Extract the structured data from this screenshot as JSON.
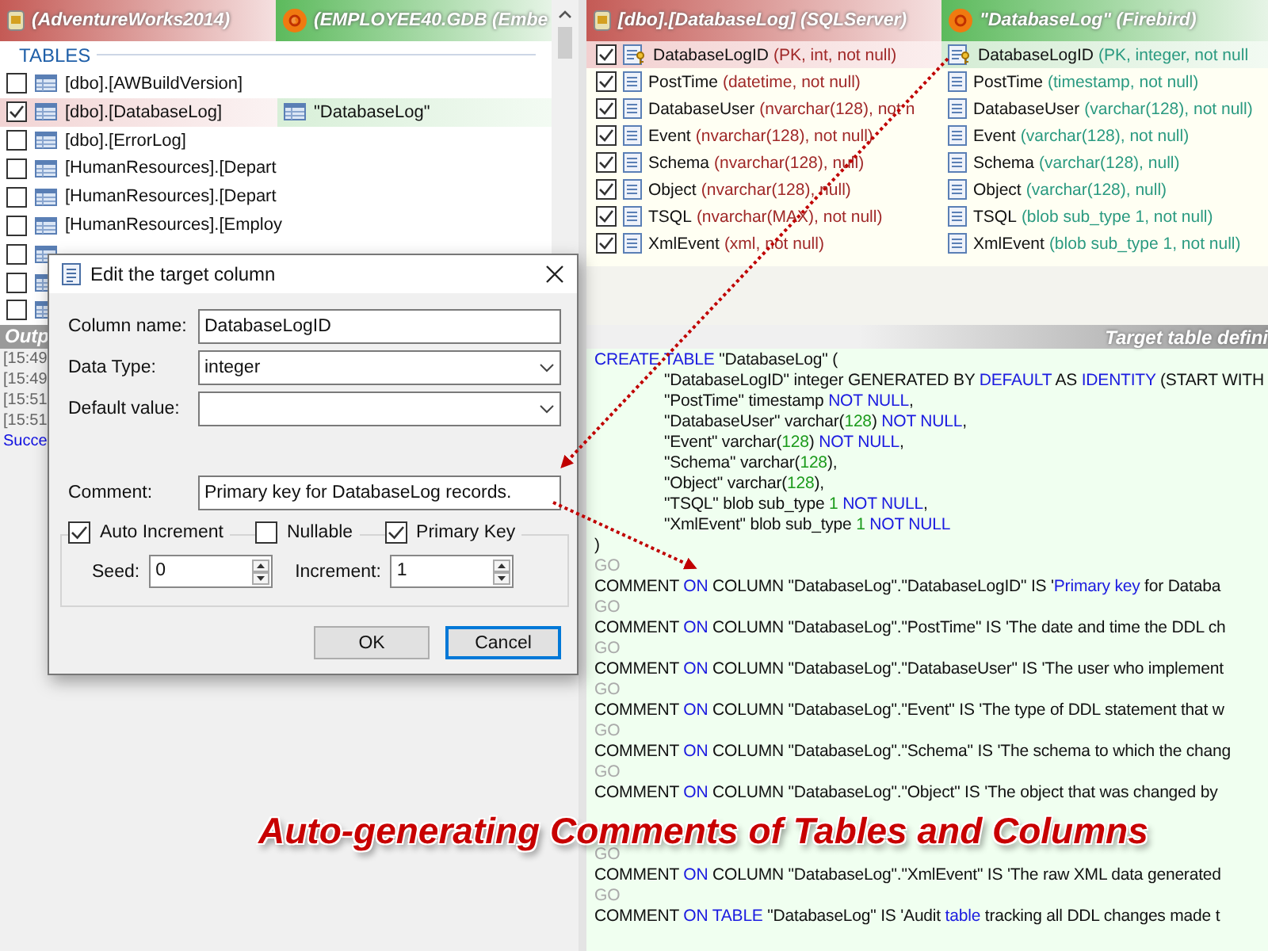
{
  "tables_pane": {
    "headers": [
      {
        "text": "(AdventureWorks2014)",
        "kind": "source"
      },
      {
        "text": "(EMPLOYEE40.GDB (Embe",
        "kind": "target"
      }
    ],
    "section_label": "TABLES",
    "rows": [
      {
        "source": "[dbo].[AWBuildVersion]",
        "checked": false,
        "selected": false
      },
      {
        "source": "[dbo].[DatabaseLog]",
        "target": "\"DatabaseLog\"",
        "checked": true,
        "selected": true
      },
      {
        "source": "[dbo].[ErrorLog]",
        "checked": false,
        "selected": false
      },
      {
        "source": "[HumanResources].[Depart",
        "checked": false,
        "selected": false
      },
      {
        "source": "[HumanResources].[Depart",
        "checked": false,
        "selected": false
      },
      {
        "source": "[HumanResources].[Employ",
        "checked": false,
        "selected": false
      },
      {
        "checked": false,
        "selected": false
      },
      {
        "checked": false,
        "selected": false
      },
      {
        "checked": false,
        "selected": false
      }
    ]
  },
  "output_pane": {
    "title": "Outp",
    "lines": [
      {
        "text": "[15:49",
        "kind": "log"
      },
      {
        "text": "[15:49",
        "kind": "log"
      },
      {
        "text": "[15:51",
        "kind": "log"
      },
      {
        "text": "[15:51",
        "kind": "log"
      },
      {
        "text": "Succe",
        "kind": "success"
      }
    ]
  },
  "columns_pane": {
    "source_header": "[dbo].[DatabaseLog] (SQLServer)",
    "target_header": "\"DatabaseLog\" (Firebird)",
    "rows": [
      {
        "kind": "key",
        "name": "DatabaseLogID",
        "source_type": "(PK, int, not null)",
        "target_name": "DatabaseLogID",
        "target_type": "(PK, integer, not null",
        "checked": true,
        "selected": true
      },
      {
        "kind": "column",
        "name": "PostTime",
        "source_type": "(datetime, not null)",
        "target_name": "PostTime",
        "target_type": "(timestamp, not null)",
        "checked": true,
        "selected": false
      },
      {
        "kind": "column",
        "name": "DatabaseUser",
        "source_type": "(nvarchar(128), not n",
        "target_name": "DatabaseUser",
        "target_type": "(varchar(128), not null)",
        "checked": true,
        "selected": false
      },
      {
        "kind": "column",
        "name": "Event",
        "source_type": "(nvarchar(128), not null)",
        "target_name": "Event",
        "target_type": "(varchar(128), not null)",
        "checked": true,
        "selected": false
      },
      {
        "kind": "column",
        "name": "Schema",
        "source_type": "(nvarchar(128), null)",
        "target_name": "Schema",
        "target_type": "(varchar(128), null)",
        "checked": true,
        "selected": false
      },
      {
        "kind": "column",
        "name": "Object",
        "source_type": "(nvarchar(128), null)",
        "target_name": "Object",
        "target_type": "(varchar(128), null)",
        "checked": true,
        "selected": false
      },
      {
        "kind": "column",
        "name": "TSQL",
        "source_type": "(nvarchar(MAX), not null)",
        "target_name": "TSQL",
        "target_type": "(blob sub_type 1, not null)",
        "checked": true,
        "selected": false
      },
      {
        "kind": "column",
        "name": "XmlEvent",
        "source_type": "(xml, not null)",
        "target_name": "XmlEvent",
        "target_type": "(blob sub_type 1, not null)",
        "checked": true,
        "selected": false
      }
    ]
  },
  "code_pane": {
    "title": "Target table defini",
    "lines": [
      {
        "kind": "statement",
        "tokens": [
          {
            "text": "CREATE TABLE",
            "kind": "keyword"
          },
          {
            "text": " \"DatabaseLog\" (",
            "kind": "plain"
          }
        ]
      },
      {
        "kind": "definition",
        "tokens": [
          {
            "text": "\"DatabaseLogID\" integer GENERATED BY ",
            "kind": "plain"
          },
          {
            "text": "DEFAULT",
            "kind": "keyword"
          },
          {
            "text": " AS ",
            "kind": "plain"
          },
          {
            "text": "IDENTITY",
            "kind": "keyword"
          },
          {
            "text": " (START WITH",
            "kind": "plain"
          }
        ]
      },
      {
        "kind": "definition",
        "tokens": [
          {
            "text": "\"PostTime\" timestamp ",
            "kind": "plain"
          },
          {
            "text": "NOT NULL",
            "kind": "keyword"
          },
          {
            "text": ",",
            "kind": "plain"
          }
        ]
      },
      {
        "kind": "definition",
        "tokens": [
          {
            "text": "\"DatabaseUser\" varchar(",
            "kind": "plain"
          },
          {
            "text": "128",
            "kind": "number"
          },
          {
            "text": ") ",
            "kind": "plain"
          },
          {
            "text": "NOT NULL",
            "kind": "keyword"
          },
          {
            "text": ",",
            "kind": "plain"
          }
        ]
      },
      {
        "kind": "definition",
        "tokens": [
          {
            "text": "\"Event\" varchar(",
            "kind": "plain"
          },
          {
            "text": "128",
            "kind": "number"
          },
          {
            "text": ") ",
            "kind": "plain"
          },
          {
            "text": "NOT NULL",
            "kind": "keyword"
          },
          {
            "text": ",",
            "kind": "plain"
          }
        ]
      },
      {
        "kind": "definition",
        "tokens": [
          {
            "text": "\"Schema\" varchar(",
            "kind": "plain"
          },
          {
            "text": "128",
            "kind": "number"
          },
          {
            "text": "),",
            "kind": "plain"
          }
        ]
      },
      {
        "kind": "definition",
        "tokens": [
          {
            "text": "\"Object\" varchar(",
            "kind": "plain"
          },
          {
            "text": "128",
            "kind": "number"
          },
          {
            "text": "),",
            "kind": "plain"
          }
        ]
      },
      {
        "kind": "definition",
        "tokens": [
          {
            "text": "\"TSQL\" blob sub_type ",
            "kind": "plain"
          },
          {
            "text": "1",
            "kind": "number"
          },
          {
            "text": " NOT NULL",
            "kind": "keyword"
          },
          {
            "text": ",",
            "kind": "plain"
          }
        ]
      },
      {
        "kind": "definition",
        "tokens": [
          {
            "text": "\"XmlEvent\" blob sub_type ",
            "kind": "plain"
          },
          {
            "text": "1",
            "kind": "number"
          },
          {
            "text": " NOT NULL",
            "kind": "keyword"
          }
        ]
      },
      {
        "kind": "statement",
        "tokens": [
          {
            "text": ")",
            "kind": "plain"
          }
        ]
      },
      {
        "kind": "statement",
        "tokens": [
          {
            "text": "GO",
            "kind": "separator"
          }
        ]
      },
      {
        "kind": "statement",
        "tokens": [
          {
            "text": "COMMENT ",
            "kind": "plain"
          },
          {
            "text": "ON",
            "kind": "keyword"
          },
          {
            "text": " COLUMN \"DatabaseLog\".\"DatabaseLogID\" IS '",
            "kind": "plain"
          },
          {
            "text": "Primary key",
            "kind": "keyword"
          },
          {
            "text": " for Databa",
            "kind": "plain"
          }
        ]
      },
      {
        "kind": "statement",
        "tokens": [
          {
            "text": "GO",
            "kind": "separator"
          }
        ]
      },
      {
        "kind": "statement",
        "tokens": [
          {
            "text": "COMMENT ",
            "kind": "plain"
          },
          {
            "text": "ON",
            "kind": "keyword"
          },
          {
            "text": " COLUMN \"DatabaseLog\".\"PostTime\" IS 'The date and time the DDL ch",
            "kind": "plain"
          }
        ]
      },
      {
        "kind": "statement",
        "tokens": [
          {
            "text": "GO",
            "kind": "separator"
          }
        ]
      },
      {
        "kind": "statement",
        "tokens": [
          {
            "text": "COMMENT ",
            "kind": "plain"
          },
          {
            "text": "ON",
            "kind": "keyword"
          },
          {
            "text": " COLUMN \"DatabaseLog\".\"DatabaseUser\" IS 'The user who implement",
            "kind": "plain"
          }
        ]
      },
      {
        "kind": "statement",
        "tokens": [
          {
            "text": "GO",
            "kind": "separator"
          }
        ]
      },
      {
        "kind": "statement",
        "tokens": [
          {
            "text": "COMMENT ",
            "kind": "plain"
          },
          {
            "text": "ON",
            "kind": "keyword"
          },
          {
            "text": " COLUMN \"DatabaseLog\".\"Event\" IS 'The type of DDL statement that w",
            "kind": "plain"
          }
        ]
      },
      {
        "kind": "statement",
        "tokens": [
          {
            "text": "GO",
            "kind": "separator"
          }
        ]
      },
      {
        "kind": "statement",
        "tokens": [
          {
            "text": "COMMENT ",
            "kind": "plain"
          },
          {
            "text": "ON",
            "kind": "keyword"
          },
          {
            "text": " COLUMN \"DatabaseLog\".\"Schema\" IS 'The schema to which the chang",
            "kind": "plain"
          }
        ]
      },
      {
        "kind": "statement",
        "tokens": [
          {
            "text": "GO",
            "kind": "separator"
          }
        ]
      },
      {
        "kind": "statement",
        "tokens": [
          {
            "text": "COMMENT ",
            "kind": "plain"
          },
          {
            "text": "ON",
            "kind": "keyword"
          },
          {
            "text": " COLUMN \"DatabaseLog\".\"Object\" IS 'The object that was changed by",
            "kind": "plain"
          }
        ]
      },
      {
        "kind": "covered"
      },
      {
        "kind": "statement",
        "tokens": [
          {
            "text": "GO",
            "kind": "separator"
          }
        ]
      },
      {
        "kind": "statement",
        "tokens": [
          {
            "text": "COMMENT ",
            "kind": "plain"
          },
          {
            "text": "ON",
            "kind": "keyword"
          },
          {
            "text": " COLUMN \"DatabaseLog\".\"XmlEvent\" IS 'The raw XML data generated",
            "kind": "plain"
          }
        ]
      },
      {
        "kind": "statement",
        "tokens": [
          {
            "text": "GO",
            "kind": "separator"
          }
        ]
      },
      {
        "kind": "statement",
        "tokens": [
          {
            "text": "COMMENT ",
            "kind": "plain"
          },
          {
            "text": "ON TABLE",
            "kind": "keyword"
          },
          {
            "text": " \"DatabaseLog\" IS 'Audit ",
            "kind": "plain"
          },
          {
            "text": "table",
            "kind": "keyword"
          },
          {
            "text": " tracking all DDL changes made t",
            "kind": "plain"
          }
        ]
      }
    ]
  },
  "dialog": {
    "title": "Edit the target column",
    "fields": [
      {
        "label": "Column name:",
        "kind": "text",
        "value": "DatabaseLogID"
      },
      {
        "label": "Data Type:",
        "kind": "dropdown",
        "value": "integer"
      },
      {
        "label": "Default value:",
        "kind": "dropdown"
      }
    ],
    "comment": {
      "label": "Comment:",
      "value": "Primary key for DatabaseLog records."
    },
    "options": [
      {
        "label": "Auto Increment",
        "checked": true
      },
      {
        "label": "Nullable",
        "checked": false
      },
      {
        "label": "Primary Key",
        "checked": true
      }
    ],
    "spinners": [
      {
        "label": "Seed:",
        "value": "0"
      },
      {
        "label": "Increment:",
        "value": "1"
      }
    ],
    "buttons": [
      {
        "label": "OK",
        "focused": false
      },
      {
        "label": "Cancel",
        "focused": true
      }
    ]
  },
  "caption": "Auto-generating Comments of Tables and Columns"
}
